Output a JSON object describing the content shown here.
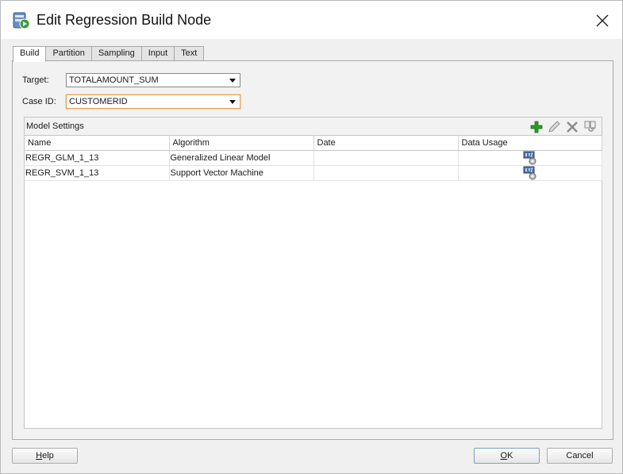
{
  "window": {
    "title": "Edit Regression Build Node",
    "icon": "regression-build-node-icon"
  },
  "tabs": [
    {
      "label": "Build",
      "active": true
    },
    {
      "label": "Partition",
      "active": false
    },
    {
      "label": "Sampling",
      "active": false
    },
    {
      "label": "Input",
      "active": false
    },
    {
      "label": "Text",
      "active": false
    }
  ],
  "form": {
    "target_label": "Target:",
    "target_value": "TOTALAMOUNT_SUM",
    "case_id_label": "Case ID:",
    "case_id_value": "CUSTOMERID"
  },
  "model_settings": {
    "title": "Model Settings",
    "toolbar_icons": [
      "add-icon",
      "edit-icon",
      "delete-icon",
      "copy-icon"
    ],
    "columns": [
      "Name",
      "Algorithm",
      "Date",
      "Data Usage"
    ],
    "rows": [
      {
        "name": "REGR_GLM_1_13",
        "algorithm": "Generalized Linear Model",
        "date": "",
        "usage_icon": "data-usage-icon"
      },
      {
        "name": "REGR_SVM_1_13",
        "algorithm": "Support Vector Machine",
        "date": "",
        "usage_icon": "data-usage-icon"
      }
    ]
  },
  "buttons": {
    "help_first": "H",
    "help_rest": "elp",
    "ok_first": "O",
    "ok_rest": "K",
    "cancel": "Cancel"
  },
  "colors": {
    "add_green": "#2a9d2a",
    "focus_orange": "#e8a05a"
  }
}
